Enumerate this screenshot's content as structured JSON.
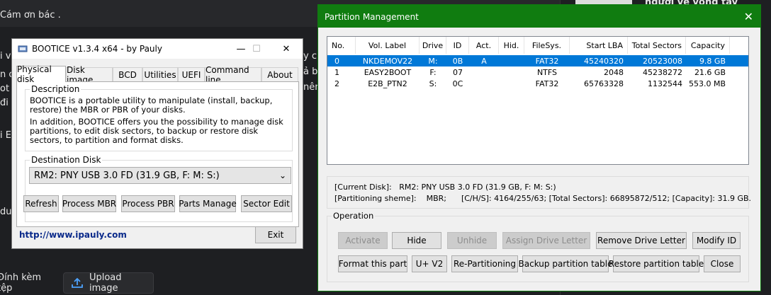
{
  "background": {
    "top_text": "Cám ơn bác .",
    "side_fragments": [
      "i v",
      "n c",
      "ot",
      "đi",
      "i E",
      "du"
    ],
    "right_fragments": [
      "y ch",
      "ả ba",
      "nên"
    ],
    "right_panel_text": "người vẽ vòng tay",
    "attach_label": "Đính kèm tệp",
    "upload_label": "Upload image"
  },
  "bootice": {
    "title": "BOOTICE v1.3.4 x64 - by Pauly",
    "controls": {
      "minimize": "—",
      "maximize": "☐",
      "close": "✕"
    },
    "tabs": [
      "Physical disk",
      "Disk image",
      "BCD",
      "Utilities",
      "UEFI",
      "Command line",
      "About"
    ],
    "description": {
      "label": "Description",
      "para1": "BOOTICE is a portable utility to manipulate (install, backup, restore) the MBR or PBR of your disks.",
      "para2": "In addition, BOOTICE offers you the possibility to manage disk partitions, to edit disk sectors, to backup or restore disk sectors, to partition and format disks."
    },
    "destination": {
      "label": "Destination Disk",
      "selected": "RM2: PNY USB 3.0 FD (31.9 GB, F: M: S:)"
    },
    "buttons": {
      "refresh": "Refresh",
      "process_mbr": "Process MBR",
      "process_pbr": "Process PBR",
      "parts_manage": "Parts Manage",
      "sector_edit": "Sector Edit",
      "exit": "Exit"
    },
    "link": "http://www.ipauly.com"
  },
  "partition_management": {
    "title": "Partition Management",
    "close": "✕",
    "columns": [
      "No.",
      "Vol. Label",
      "Drive",
      "ID",
      "Act.",
      "Hid.",
      "FileSys.",
      "Start LBA",
      "Total Sectors",
      "Capacity"
    ],
    "rows": [
      {
        "no": "0",
        "label": "NKDEMOV22",
        "drive": "M:",
        "id": "0B",
        "act": "A",
        "hid": "",
        "fs": "FAT32",
        "start": "45240320",
        "total": "20523008",
        "cap": "9.8 GB"
      },
      {
        "no": "1",
        "label": "EASY2BOOT",
        "drive": "F:",
        "id": "07",
        "act": "",
        "hid": "",
        "fs": "NTFS",
        "start": "2048",
        "total": "45238272",
        "cap": "21.6 GB"
      },
      {
        "no": "2",
        "label": "E2B_PTN2",
        "drive": "S:",
        "id": "0C",
        "act": "",
        "hid": "",
        "fs": "FAT32",
        "start": "65763328",
        "total": "1132544",
        "cap": "553.0 MB"
      }
    ],
    "selected_row": 0,
    "info": {
      "current_disk": "[Current Disk]:   RM2: PNY USB 3.0 FD (31.9 GB, F: M: S:)",
      "partitioning": "[Partitioning sheme]:    MBR;      [C/H/S]: 4164/255/63; [Total Sectors]: 66895872/512; [Capacity]: 31.9 GB."
    },
    "operation_label": "Operation",
    "buttons": {
      "activate": "Activate",
      "hide": "Hide",
      "unhide": "Unhide",
      "assign_letter": "Assign Drive Letter",
      "remove_letter": "Remove Drive Letter",
      "modify_id": "Modify ID",
      "format_part": "Format this part",
      "uv2": "U+ V2",
      "repartition": "Re-Partitioning",
      "backup_table": "Backup partition table",
      "restore_table": "Restore partition table",
      "close": "Close"
    }
  }
}
